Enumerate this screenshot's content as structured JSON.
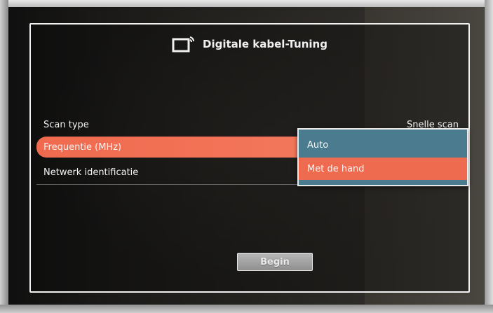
{
  "dialog": {
    "title": "Digitale kabel-Tuning",
    "icon": "tv-antenna-icon"
  },
  "settings": [
    {
      "label": "Scan type",
      "value": "Snelle scan"
    },
    {
      "label": "Frequentie (MHz)",
      "value": ""
    },
    {
      "label": "Netwerk identificatie",
      "value": ""
    }
  ],
  "dropdown": {
    "options": [
      "Auto",
      "Met de hand"
    ],
    "selected": "Met de hand"
  },
  "buttons": {
    "begin": "Begin"
  },
  "colors": {
    "highlight": "#f06a4f",
    "dropdown_bg": "#4a7b8e",
    "panel_border": "#f2f2f2"
  }
}
